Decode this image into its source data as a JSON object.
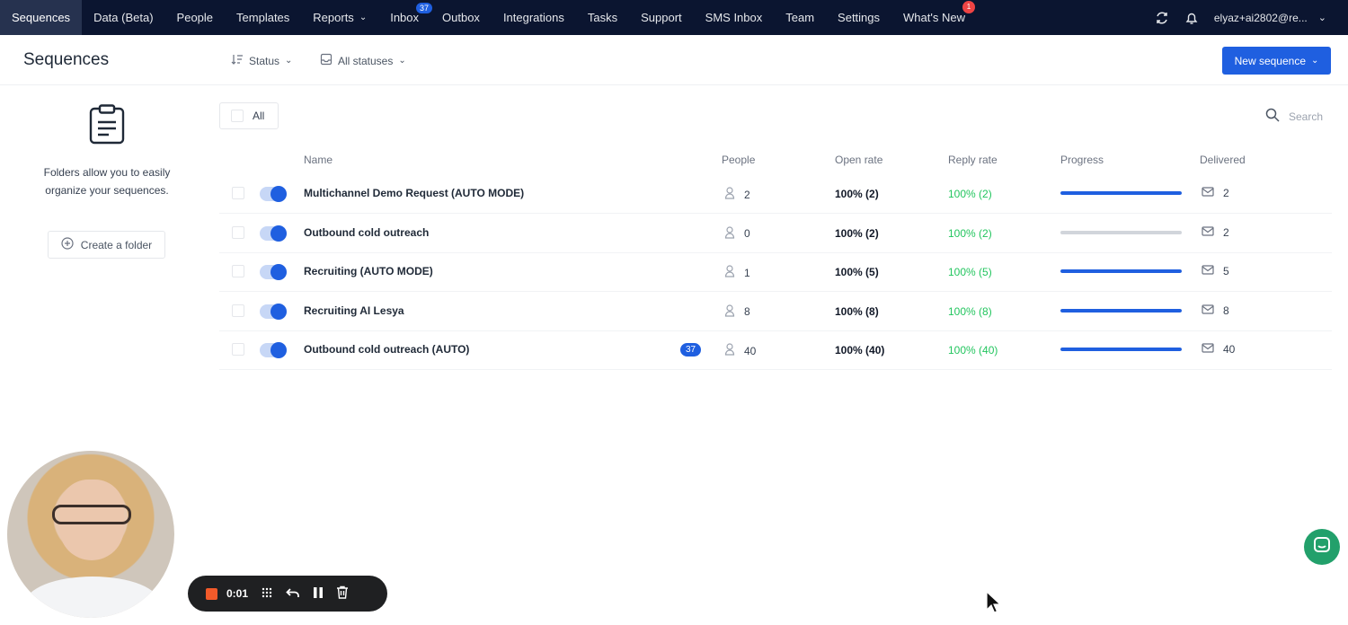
{
  "nav": {
    "items": [
      {
        "label": "Sequences"
      },
      {
        "label": "Data (Beta)"
      },
      {
        "label": "People"
      },
      {
        "label": "Templates"
      },
      {
        "label": "Reports"
      },
      {
        "label": "Inbox",
        "badge": "37"
      },
      {
        "label": "Outbox"
      },
      {
        "label": "Integrations"
      },
      {
        "label": "Tasks"
      },
      {
        "label": "Support"
      },
      {
        "label": "SMS Inbox"
      },
      {
        "label": "Team"
      },
      {
        "label": "Settings"
      },
      {
        "label": "What's New",
        "badge": "1"
      }
    ],
    "user": "elyaz+ai2802@re..."
  },
  "header": {
    "title": "Sequences",
    "status_filter": "Status",
    "all_statuses_filter": "All statuses",
    "new_sequence": "New sequence"
  },
  "sidebar": {
    "folders_text": "Folders allow you to easily organize your sequences.",
    "create_folder": "Create a folder"
  },
  "toolbar": {
    "all_label": "All",
    "search_placeholder": "Search"
  },
  "table": {
    "columns": [
      "Name",
      "People",
      "Open rate",
      "Reply rate",
      "Progress",
      "Delivered"
    ],
    "rows": [
      {
        "name": "Multichannel Demo Request (AUTO MODE)",
        "people": "2",
        "open_rate": "100% (2)",
        "reply_rate": "100% (2)",
        "progress": 1.0,
        "delivered": "2",
        "badge": ""
      },
      {
        "name": "Outbound cold outreach",
        "people": "0",
        "open_rate": "100% (2)",
        "reply_rate": "100% (2)",
        "progress": 0.0,
        "delivered": "2",
        "badge": ""
      },
      {
        "name": "Recruiting (AUTO MODE)",
        "people": "1",
        "open_rate": "100% (5)",
        "reply_rate": "100% (5)",
        "progress": 1.0,
        "delivered": "5",
        "badge": ""
      },
      {
        "name": "Recruiting AI Lesya",
        "people": "8",
        "open_rate": "100% (8)",
        "reply_rate": "100% (8)",
        "progress": 1.0,
        "delivered": "8",
        "badge": ""
      },
      {
        "name": "Outbound cold outreach (AUTO)",
        "people": "40",
        "open_rate": "100% (40)",
        "reply_rate": "100% (40)",
        "progress": 1.0,
        "delivered": "40",
        "badge": "37"
      }
    ]
  },
  "recorder": {
    "time": "0:01"
  },
  "colors": {
    "nav_bg": "#0b1530",
    "accent": "#1f5fe0",
    "reply_green": "#22c55e",
    "badge_red": "#ef4444",
    "chat_green": "#22a06b"
  }
}
